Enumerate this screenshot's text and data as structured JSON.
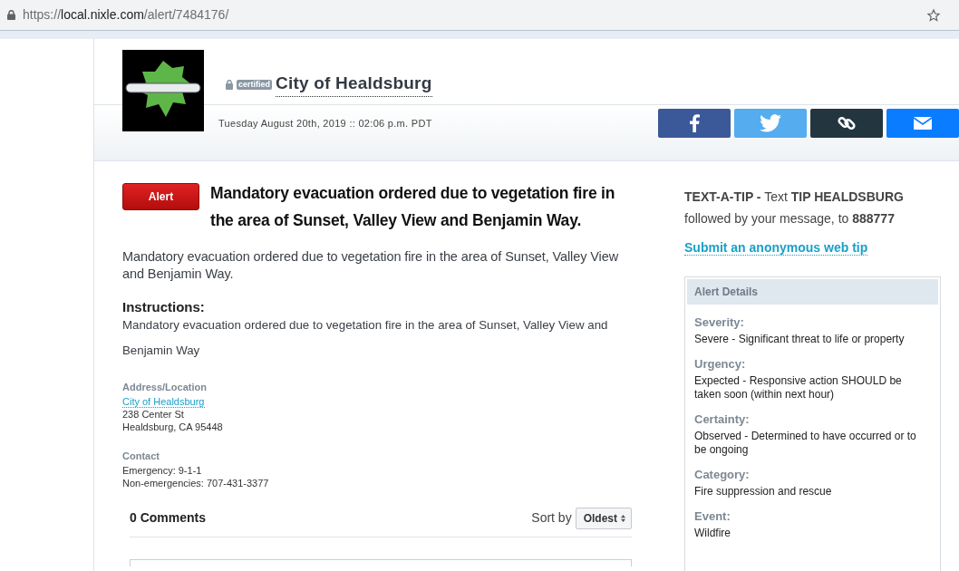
{
  "browser": {
    "url_scheme": "https://",
    "url_host": "local.nixle.com",
    "url_path": "/alert/7484176/"
  },
  "agency": {
    "badge": "certified",
    "name": "City of Healdsburg",
    "date": "Tuesday August 20th, 2019 :: 02:06 p.m. PDT"
  },
  "share_buttons": [
    {
      "kind": "facebook"
    },
    {
      "kind": "twitter"
    },
    {
      "kind": "link"
    },
    {
      "kind": "email"
    }
  ],
  "alert": {
    "tag": "Alert",
    "headline": "Mandatory evacuation ordered due to vegetation fire in the area of Sunset, Valley View and Benjamin Way.",
    "body": "Mandatory evacuation ordered due to vegetation fire in the area of Sunset, Valley View and Benjamin Way.",
    "instructions_label": "Instructions:",
    "instructions": "Mandatory evacuation ordered due to vegetation fire in the area of Sunset, Valley View and Benjamin Way",
    "address_label": "Address/Location",
    "address_link": "City of Healdsburg",
    "address_lines": [
      "238 Center St",
      "Healdsburg, CA 95448"
    ],
    "contact_label": "Contact",
    "contact_lines": [
      "Emergency: 9-1-1",
      "Non-emergencies: 707-431-3377"
    ]
  },
  "comments": {
    "count": "0 Comments",
    "sort_label": "Sort by",
    "sort_value": "Oldest"
  },
  "tip": {
    "text": "**TEXT-A-TIP -**  Text **TIP HEALDSBURG** followed by your message, to **888777**",
    "link": "Submit an anonymous web tip"
  },
  "details": {
    "title": "Alert Details",
    "items": [
      {
        "label": "Severity:",
        "value": "Severe - Significant threat to life or property"
      },
      {
        "label": "Urgency:",
        "value": "Expected - Responsive action SHOULD be taken soon (within next hour)"
      },
      {
        "label": "Certainty:",
        "value": "Observed - Determined to have occurred or to be ongoing"
      },
      {
        "label": "Category:",
        "value": "Fire suppression and rescue"
      },
      {
        "label": "Event:",
        "value": "Wildfire"
      }
    ]
  }
}
